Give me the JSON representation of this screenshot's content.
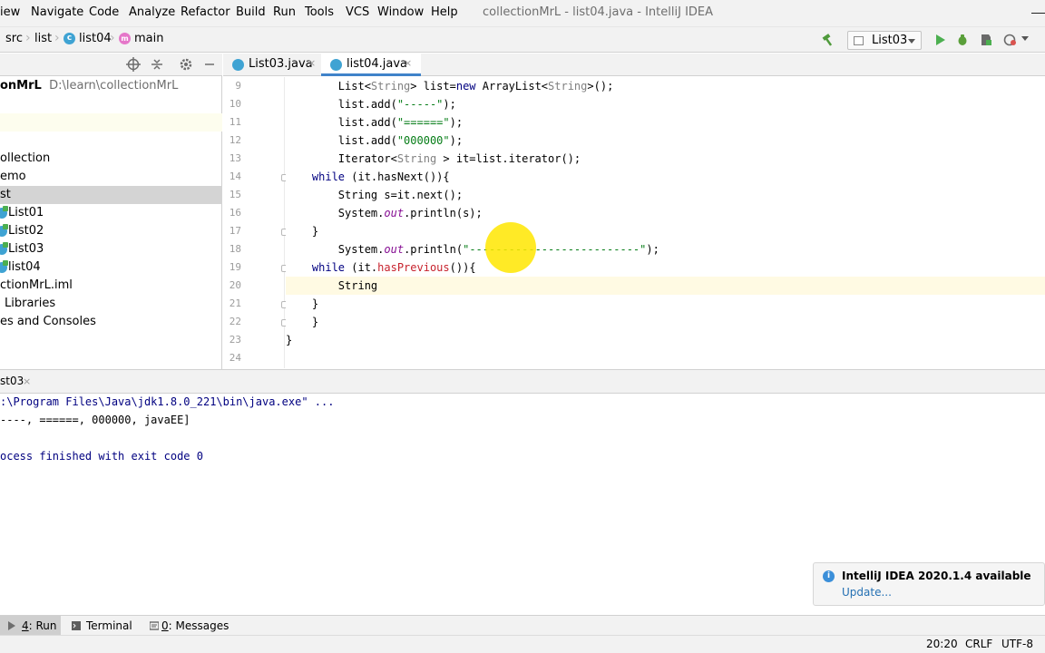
{
  "menu": {
    "items": [
      "iew",
      "Navigate",
      "Code",
      "Analyze",
      "Refactor",
      "Build",
      "Run",
      "Tools",
      "VCS",
      "Window",
      "Help"
    ]
  },
  "window_title": "collectionMrL - list04.java - IntelliJ IDEA",
  "breadcrumb": {
    "items": [
      "src",
      "list",
      "list04",
      "main"
    ]
  },
  "run_config": {
    "selected": "List03"
  },
  "project_tree": {
    "root_name": "onMrL",
    "root_path": "D:\\learn\\collectionMrL",
    "items": [
      "ollection",
      "emo",
      "st",
      "List01",
      "List02",
      "List03",
      "list04",
      "ctionMrL.iml",
      "Libraries",
      "es and Consoles"
    ]
  },
  "editor": {
    "tabs": [
      {
        "label": "List03.java",
        "active": false
      },
      {
        "label": "list04.java",
        "active": true
      }
    ],
    "line_numbers": [
      "9",
      "10",
      "11",
      "12",
      "13",
      "14",
      "15",
      "16",
      "17",
      "18",
      "19",
      "20",
      "21",
      "22",
      "23",
      "24"
    ],
    "lines": [
      "        List<String> list=new ArrayList<String>();",
      "        list.add(\"-----\");",
      "        list.add(\"======\");",
      "        list.add(\"000000\");",
      "        Iterator<String > it=list.iterator();",
      "    while (it.hasNext()){",
      "        String s=it.next();",
      "        System.out.println(s);",
      "    }",
      "        System.out.println(\"--------------------------\");",
      "    while (it.hasPrevious()){",
      "        String ",
      "    }",
      "    }",
      "}",
      ""
    ]
  },
  "run_panel": {
    "tab_label": "st03",
    "close_glyph": "×",
    "console": [
      ":\\Program Files\\Java\\jdk1.8.0_221\\bin\\java.exe\" ...",
      "----, ======, 000000, javaEE]",
      "",
      "ocess finished with exit code 0"
    ]
  },
  "notification": {
    "title": "IntelliJ IDEA 2020.1.4 available",
    "link": "Update..."
  },
  "tool_windows": [
    {
      "number": "4",
      "label": ": Run",
      "active": true
    },
    {
      "number": "",
      "label": "Terminal",
      "active": false
    },
    {
      "number": "0",
      "label": ": Messages",
      "active": false
    }
  ],
  "status_bar": {
    "position": "20:20",
    "line_separator": "CRLF",
    "encoding": "UTF-8"
  },
  "colors": {
    "accent": "#4083c9",
    "keyword": "#000080",
    "string": "#067d17",
    "static_italic": "#871094",
    "error": "#c7222d",
    "cursor_highlight": "#ffe600"
  }
}
